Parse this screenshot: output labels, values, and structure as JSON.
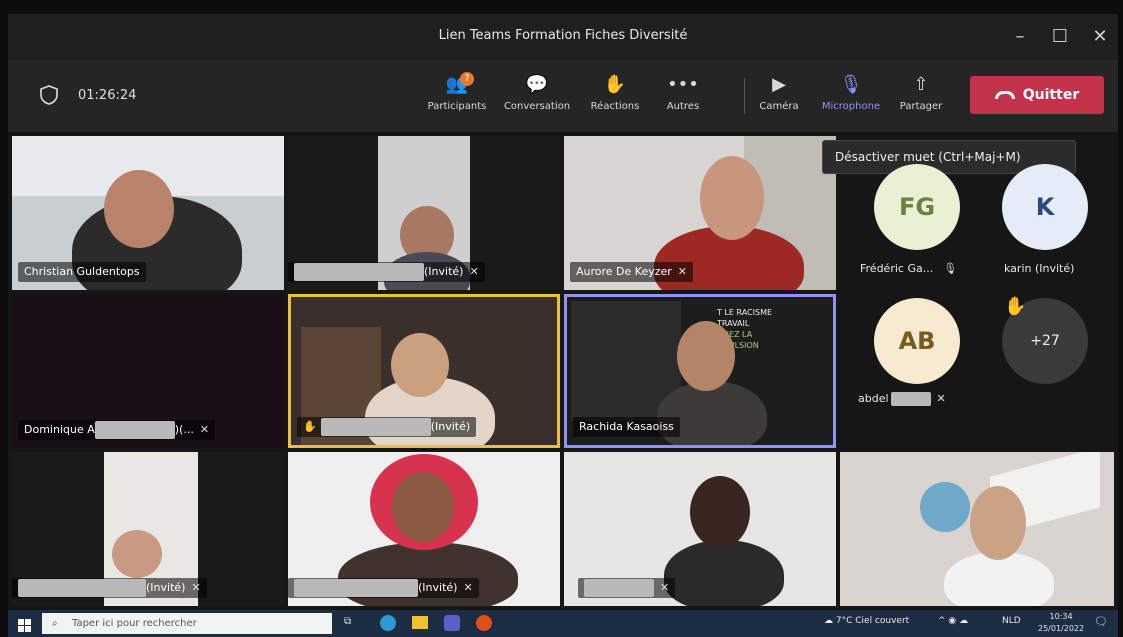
{
  "window": {
    "title": "Lien Teams Formation Fiches Diversité"
  },
  "meeting": {
    "timer": "01:26:24",
    "participants_badge": "7"
  },
  "toolbar": {
    "participants": "Participants",
    "conversation": "Conversation",
    "reactions": "Réactions",
    "more": "Autres",
    "camera": "Caméra",
    "microphone": "Microphone",
    "share": "Partager",
    "quit": "Quitter"
  },
  "tooltip": {
    "mic": "Désactiver muet (Ctrl+Maj+M)"
  },
  "tiles": {
    "t1": "Christian Guldentops",
    "t2_suffix": "(Invité)",
    "t3": "Aurore De Keyzer",
    "t4_prefix": "Dominique A",
    "t4_suffix": ")(...",
    "t5_suffix": "(Invité)",
    "t6": "Rachida Kasaoiss",
    "t7_suffix": "(Invité)",
    "t8_suffix": "(Invité)",
    "poster_line1": "T LE RACISME",
    "poster_line2": "TRAVAIL",
    "poster_line3": "NNEZ LA",
    "poster_line4": "MPULSION"
  },
  "sidebar": {
    "fg_initials": "FG",
    "fg_name": "Frédéric Ga...",
    "k_initials": "K",
    "k_name": "karin (Invité)",
    "ab_initials": "AB",
    "ab_name": "abdel",
    "overflow": "+27"
  },
  "taskbar": {
    "search_placeholder": "Taper ici pour rechercher",
    "weather": "7°C Ciel couvert",
    "lang": "NLD",
    "time": "10:34",
    "date": "25/01/2022"
  },
  "colors": {
    "quit": "#c4314b",
    "speaker_border": "#e8c23a",
    "pin_border": "#8f93f2"
  }
}
